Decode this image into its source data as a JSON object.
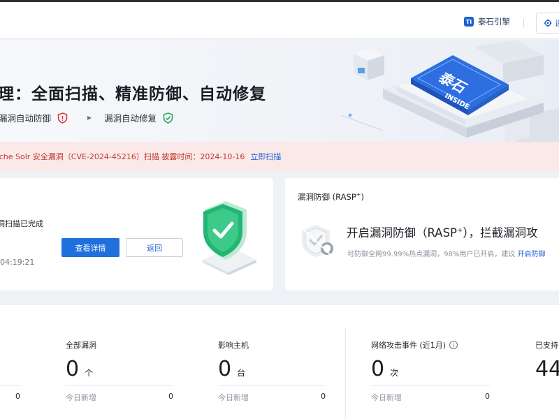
{
  "header": {
    "brand_label": "泰石引擎",
    "brand_logo_text": "TI",
    "settings_label": "设"
  },
  "hero": {
    "title": "理：全面扫描、精准防御、自动修复",
    "step_defense": "漏洞自动防御",
    "step_repair": "漏洞自动修复",
    "chip_line1": "泰石",
    "chip_line2": "INSIDE"
  },
  "alert": {
    "text": "ache Solr 安全漏洞（CVE-2024-45216）扫描  披露时间：2024-10-16",
    "link": "立即扫描"
  },
  "scan_card": {
    "status": "洞扫描已完成",
    "time": "04:19:21",
    "view_details": "查看详情",
    "back": "返回"
  },
  "rasp_card": {
    "title": "漏洞防御 (RASP",
    "title_sup": "+",
    "title_close": ")",
    "headline": "开启漏洞防御（RASP",
    "headline_sup": "+",
    "headline_tail": "），拦截漏洞攻",
    "desc": "可防御全网99.99%热点漏洞，98%用户已开启，建议",
    "desc_link": "开启防御"
  },
  "stats": [
    {
      "label": "",
      "value": "",
      "unit": "",
      "today_label": "",
      "today_value": "0"
    },
    {
      "label": "全部漏洞",
      "value": "0",
      "unit": "个",
      "today_label": "今日新增",
      "today_value": "0"
    },
    {
      "label": "影响主机",
      "value": "0",
      "unit": "台",
      "today_label": "今日新增",
      "today_value": "0"
    },
    {
      "label": "网络攻击事件 (近1月)",
      "value": "0",
      "unit": "次",
      "today_label": "今日新增",
      "today_value": "0",
      "info": "i"
    },
    {
      "label": "已支持",
      "value": "44",
      "unit": "",
      "today_label": "",
      "today_value": ""
    }
  ],
  "colors": {
    "primary": "#1f6fdc",
    "alert_bg": "#fbe8e8",
    "alert_text": "#c0392b",
    "shield_green": "#22b573"
  }
}
